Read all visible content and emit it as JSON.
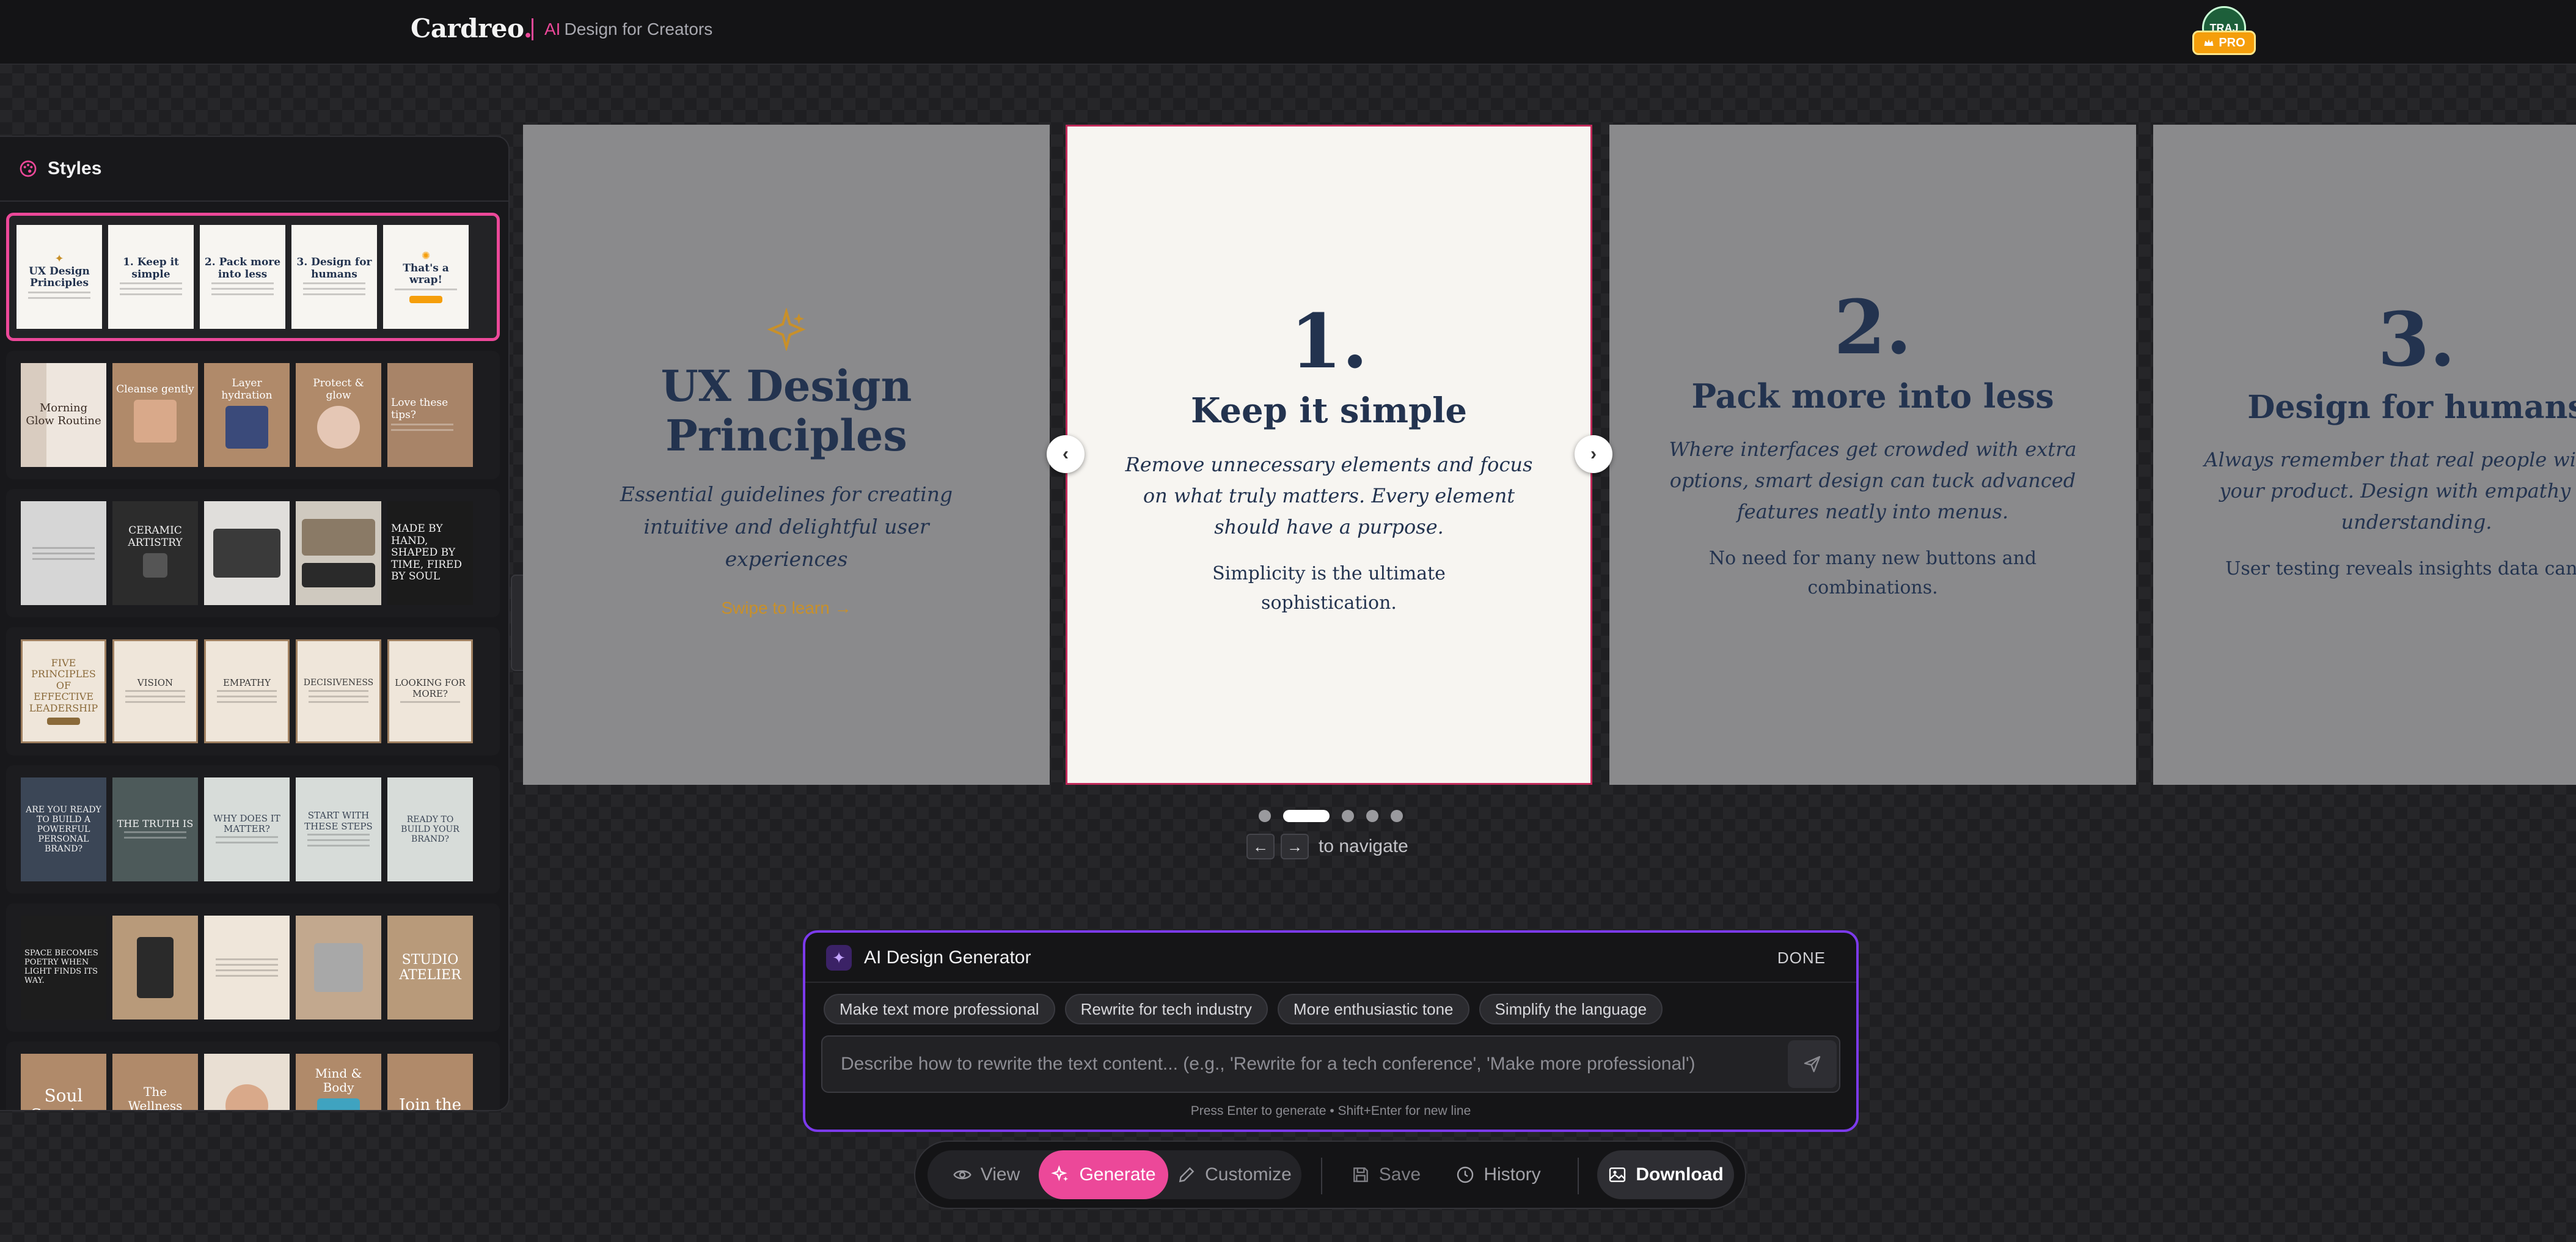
{
  "header": {
    "logo_text": "Cardreo",
    "logo_dot": ".",
    "tagline_ai": "AI",
    "tagline": "Design for Creators",
    "avatar_text": "TRAJ",
    "pro_badge": "PRO"
  },
  "styles_panel": {
    "title": "Styles",
    "rows": [
      {
        "theme": "ux-light",
        "selected": true,
        "thumbs": [
          "UX Design Principles",
          "1. Keep it simple",
          "2. Pack more into less",
          "3. Design for humans",
          "That's a wrap!"
        ]
      },
      {
        "theme": "beige-beauty",
        "thumbs": [
          "Morning Glow Routine",
          "Cleanse gently",
          "Layer hydration",
          "Protect & glow",
          "Love these tips?"
        ]
      },
      {
        "theme": "ceramic",
        "thumbs": [
          "",
          "CERAMIC ARTISTRY",
          "",
          "",
          "MADE BY HAND, SHAPED BY TIME, FIRED BY SOUL"
        ]
      },
      {
        "theme": "leadership",
        "thumbs": [
          "FIVE PRINCIPLES OF EFFECTIVE LEADERSHIP",
          "VISION",
          "EMPATHY",
          "DECISIVENESS",
          "LOOKING FOR MORE?"
        ]
      },
      {
        "theme": "brand",
        "thumbs": [
          "ARE YOU READY TO BUILD A POWERFUL PERSONAL BRAND?",
          "THE TRUTH IS",
          "WHY DOES IT MATTER?",
          "START WITH THESE STEPS",
          "READY TO BUILD YOUR BRAND?"
        ]
      },
      {
        "theme": "studio",
        "thumbs": [
          "SPACE BECOMES POETRY WHEN LIGHT FINDS ITS WAY.",
          "",
          "",
          "",
          "STUDIO ATELIER"
        ]
      },
      {
        "theme": "wellness",
        "thumbs": [
          "Soul Session",
          "The Wellness Journey",
          "",
          "Mind & Body",
          "Join the"
        ]
      }
    ]
  },
  "slides": [
    {
      "icon": "sparkle-icon",
      "title": "UX Design Principles",
      "subtitle": "Essential guidelines for creating intuitive and delightful user experiences",
      "cta": "Swipe to learn →"
    },
    {
      "number": "1.",
      "title": "Keep it simple",
      "body": "Remove unnecessary elements and focus on what truly matters. Every element should have a purpose.",
      "note": "Simplicity is the ultimate sophistication."
    },
    {
      "number": "2.",
      "title": "Pack more into less",
      "body": "Where interfaces get crowded with extra options, smart design can tuck advanced features neatly into menus.",
      "note": "No need for many new buttons and combinations."
    },
    {
      "number": "3.",
      "title": "Design for humans",
      "body": "Always remember that real people will use your product. Design with empathy and understanding.",
      "note": "User testing reveals insights data cannot"
    }
  ],
  "carousel": {
    "dots_count": 5,
    "active_index": 1,
    "prev_arrow": "‹",
    "next_arrow": "›",
    "key_left": "←",
    "key_right": "→",
    "nav_hint": "to navigate"
  },
  "ai_generator": {
    "title": "AI Design Generator",
    "done_label": "DONE",
    "chips": [
      "Make text more professional",
      "Rewrite for tech industry",
      "More enthusiastic tone",
      "Simplify the language"
    ],
    "input_placeholder": "Describe how to rewrite the text content... (e.g., 'Rewrite for a tech conference', 'Make more professional')",
    "input_value": "",
    "hint": "Press Enter to generate • Shift+Enter for new line"
  },
  "toolbar": {
    "view_label": "View",
    "generate_label": "Generate",
    "customize_label": "Customize",
    "save_label": "Save",
    "history_label": "History",
    "download_label": "Download",
    "active_mode": "Generate"
  },
  "colors": {
    "accent": "#ec4899",
    "ai_border": "#7c3aed",
    "slide_navy": "#23334f",
    "cta_gold": "#c8902a",
    "active_slide_border": "#c12a5a"
  }
}
